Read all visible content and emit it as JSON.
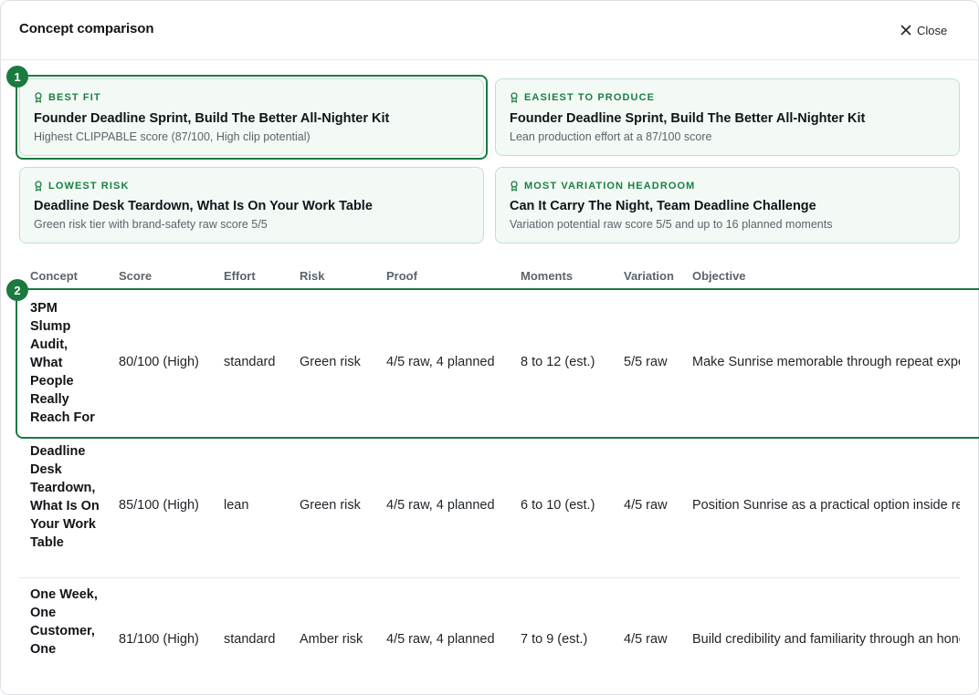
{
  "header": {
    "title": "Concept comparison",
    "close_label": "Close"
  },
  "cards": [
    {
      "label": "BEST FIT",
      "title": "Founder Deadline Sprint, Build The Better All-Nighter Kit",
      "subtitle": "Highest CLIPPABLE score (87/100, High clip potential)"
    },
    {
      "label": "EASIEST TO PRODUCE",
      "title": "Founder Deadline Sprint, Build The Better All-Nighter Kit",
      "subtitle": "Lean production effort at a 87/100 score"
    },
    {
      "label": "LOWEST RISK",
      "title": "Deadline Desk Teardown, What Is On Your Work Table",
      "subtitle": "Green risk tier with brand-safety raw score 5/5"
    },
    {
      "label": "MOST VARIATION HEADROOM",
      "title": "Can It Carry The Night, Team Deadline Challenge",
      "subtitle": "Variation potential raw score 5/5 and up to 16 planned moments"
    }
  ],
  "badges": [
    "1",
    "2"
  ],
  "table": {
    "columns": [
      "Concept",
      "Score",
      "Effort",
      "Risk",
      "Proof",
      "Moments",
      "Variation",
      "Objective"
    ],
    "rows": [
      {
        "concept": "3PM Slump Audit, What People Really Reach For",
        "score": "80/100 (High)",
        "effort": "standard",
        "risk": "Green risk",
        "proof": "4/5 raw, 4 planned",
        "moments": "8 to 12 (est.)",
        "variation": "5/5 raw",
        "objective": "Make Sunrise memorable through repeat exposure"
      },
      {
        "concept": "Deadline Desk Teardown, What Is On Your Work Table",
        "score": "85/100 (High)",
        "effort": "lean",
        "risk": "Green risk",
        "proof": "4/5 raw, 4 planned",
        "moments": "6 to 10 (est.)",
        "variation": "4/5 raw",
        "objective": "Position Sunrise as a practical option inside real routines"
      },
      {
        "concept": "One Week, One Customer, One",
        "score": "81/100 (High)",
        "effort": "standard",
        "risk": "Amber risk",
        "proof": "4/5 raw, 4 planned",
        "moments": "7 to 9 (est.)",
        "variation": "4/5 raw",
        "objective": "Build credibility and familiarity through an honest look"
      }
    ]
  }
}
